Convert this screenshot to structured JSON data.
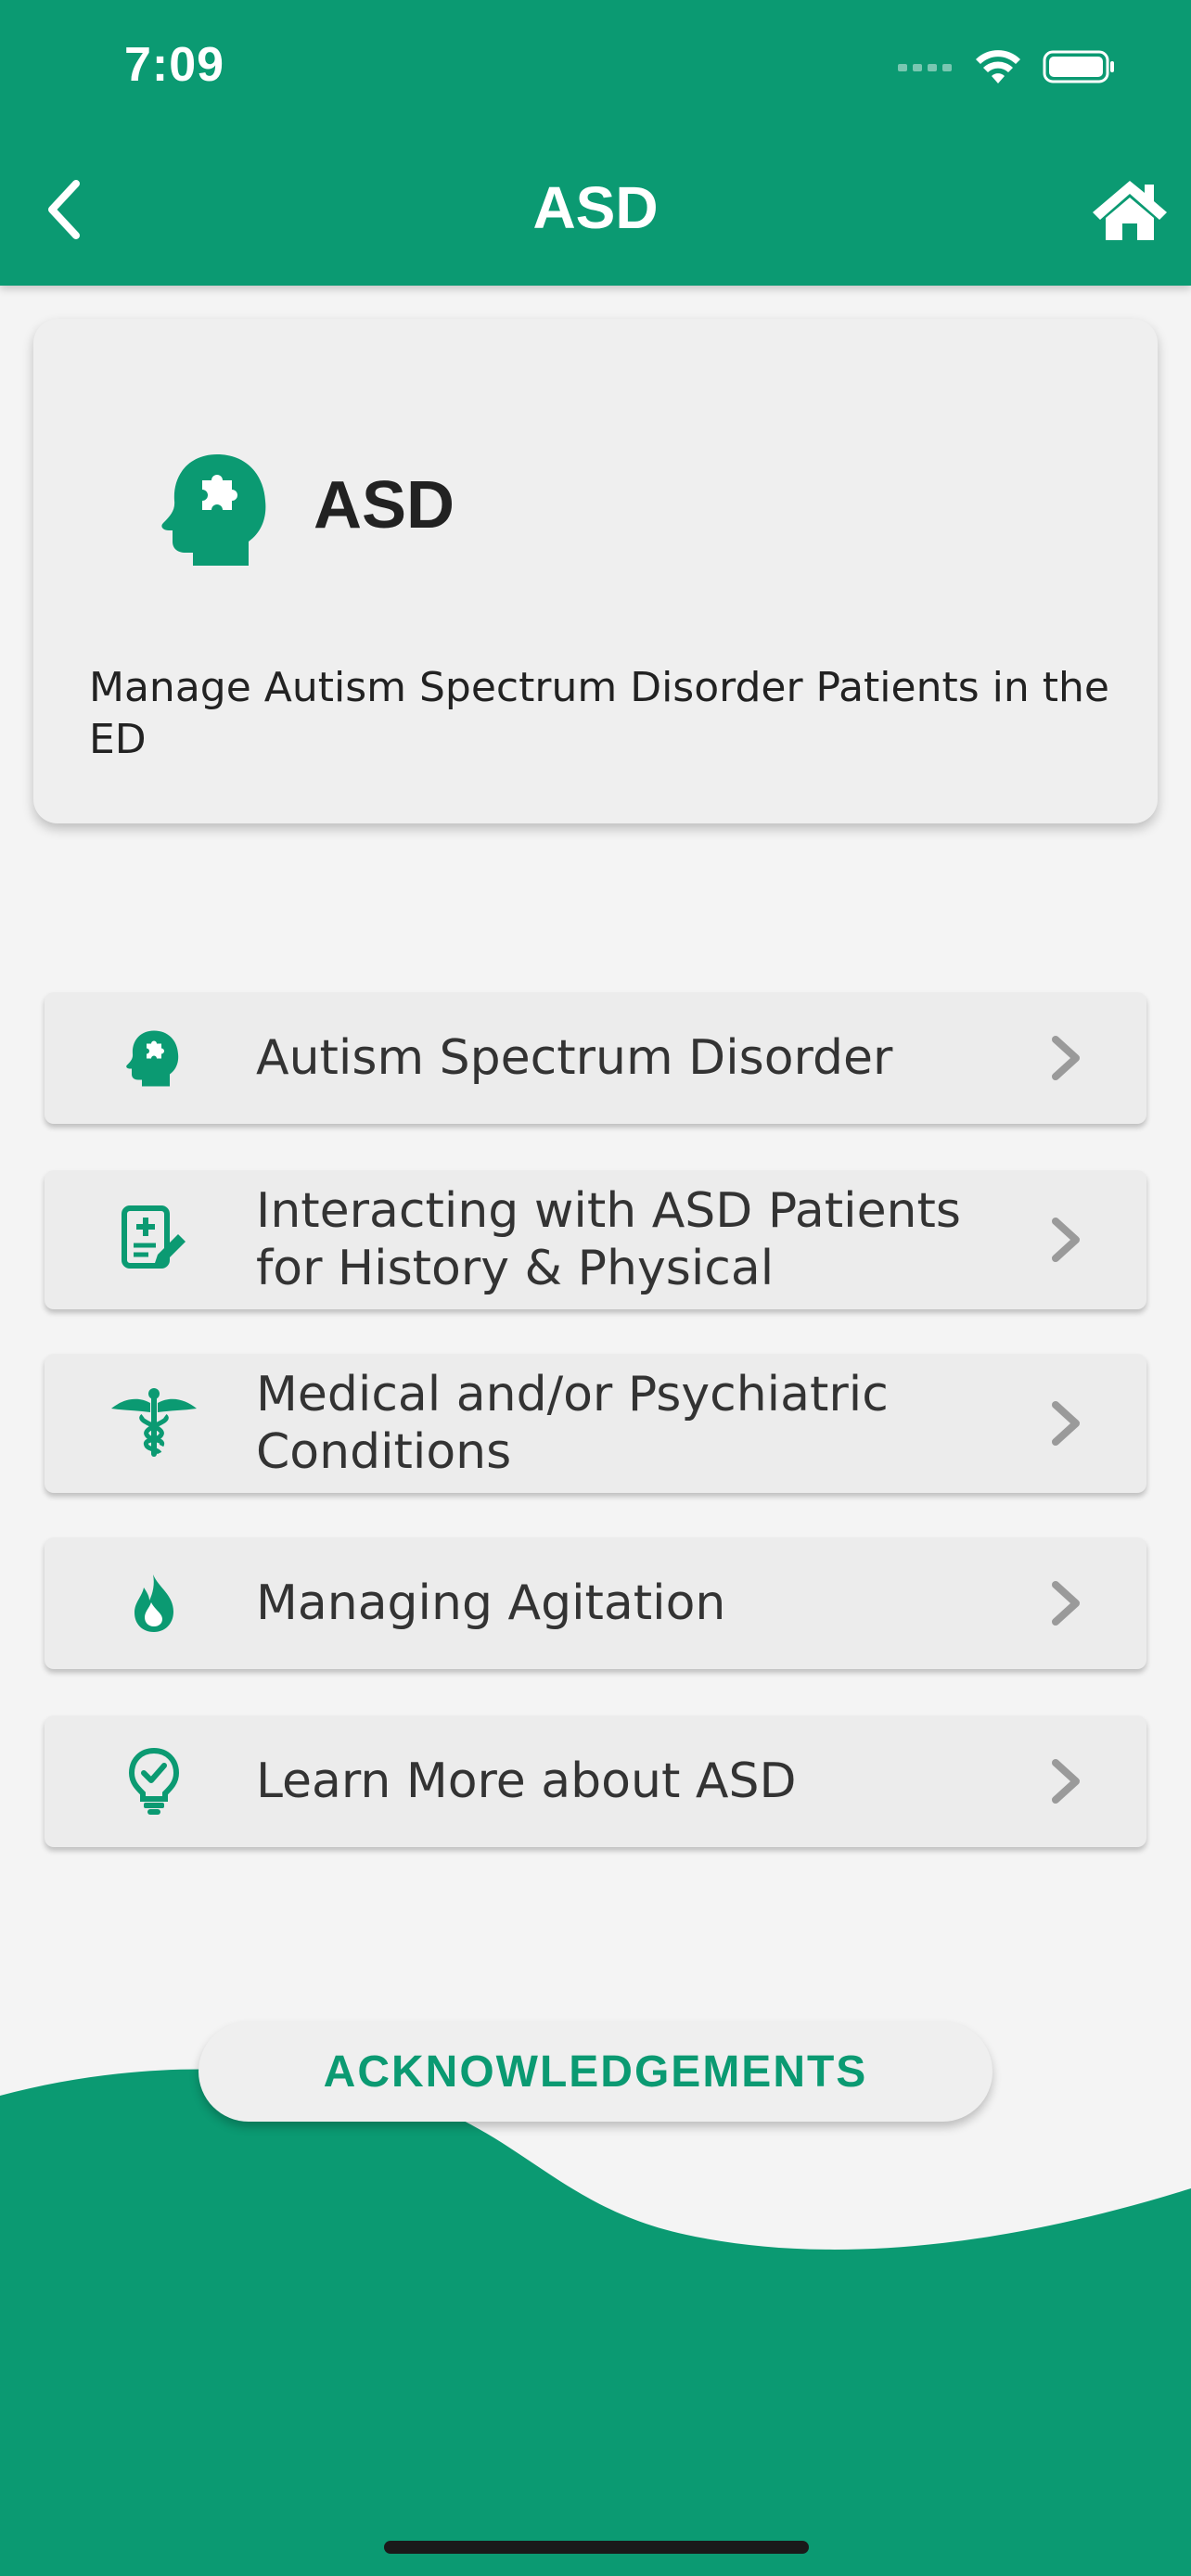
{
  "status_bar": {
    "time": "7:09"
  },
  "header": {
    "title": "ASD",
    "back_icon": "chevron-left-icon",
    "home_icon": "home-icon"
  },
  "hero": {
    "icon": "head-puzzle-icon",
    "title": "ASD",
    "description": "Manage Autism Spectrum Disorder Patients in the ED"
  },
  "menu": [
    {
      "label": "Autism Spectrum Disorder",
      "icon": "head-puzzle-icon"
    },
    {
      "label": "Interacting with ASD Patients for History & Physical",
      "icon": "medical-form-pencil-icon"
    },
    {
      "label": "Medical and/or Psychiatric Conditions",
      "icon": "caduceus-icon"
    },
    {
      "label": "Managing Agitation",
      "icon": "flame-icon"
    },
    {
      "label": "Learn More about ASD",
      "icon": "lightbulb-check-icon"
    }
  ],
  "footer": {
    "acknowledgements_label": "ACKNOWLEDGEMENTS"
  },
  "colors": {
    "primary": "#0b9a72",
    "background": "#f4f4f4",
    "card": "#efefef",
    "chevron": "#9a9a9a"
  }
}
